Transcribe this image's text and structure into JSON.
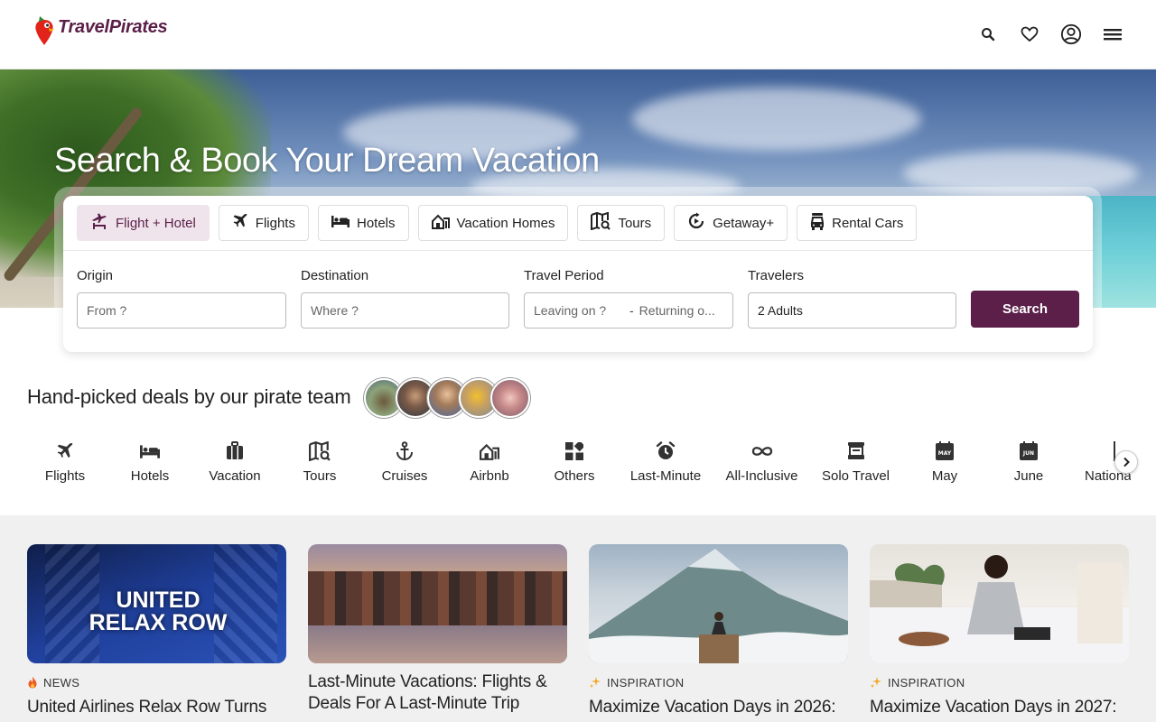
{
  "brand": {
    "name": "TravelPirates"
  },
  "header": {
    "icons": [
      "search-icon",
      "heart-icon",
      "account-icon",
      "menu-icon"
    ]
  },
  "hero": {
    "title": "Search & Book Your Dream Vacation"
  },
  "search": {
    "tabs": [
      {
        "label": "Flight + Hotel",
        "icon": "flight-hotel-icon",
        "active": true
      },
      {
        "label": "Flights",
        "icon": "plane-icon"
      },
      {
        "label": "Hotels",
        "icon": "bed-icon"
      },
      {
        "label": "Vacation Homes",
        "icon": "vacation-home-icon"
      },
      {
        "label": "Tours",
        "icon": "map-search-icon"
      },
      {
        "label": "Getaway+",
        "icon": "getaway-icon"
      },
      {
        "label": "Rental Cars",
        "icon": "car-icon"
      }
    ],
    "origin": {
      "label": "Origin",
      "placeholder": "From ?"
    },
    "destination": {
      "label": "Destination",
      "placeholder": "Where ?"
    },
    "period": {
      "label": "Travel Period",
      "leaving": "Leaving on ?",
      "separator": "-",
      "returning": "Returning o..."
    },
    "travelers": {
      "label": "Travelers",
      "value": "2 Adults"
    },
    "button": "Search"
  },
  "deals": {
    "title": "Hand-picked deals by our pirate team",
    "avatar_count": 5
  },
  "categories": [
    {
      "label": "Flights",
      "icon": "plane-icon"
    },
    {
      "label": "Hotels",
      "icon": "bed-icon"
    },
    {
      "label": "Vacation",
      "icon": "suitcase-icon"
    },
    {
      "label": "Tours",
      "icon": "map-search-icon"
    },
    {
      "label": "Cruises",
      "icon": "anchor-icon"
    },
    {
      "label": "Airbnb",
      "icon": "airbnb-icon"
    },
    {
      "label": "Others",
      "icon": "grid-icon"
    },
    {
      "label": "Last-Minute",
      "icon": "alarm-icon"
    },
    {
      "label": "All-Inclusive",
      "icon": "infinity-icon"
    },
    {
      "label": "Solo Travel",
      "icon": "backpack-icon"
    },
    {
      "label": "May",
      "icon": "calendar-may-icon"
    },
    {
      "label": "June",
      "icon": "calendar-june-icon"
    },
    {
      "label": "Nationa",
      "icon": "flag-icon"
    }
  ],
  "articles": [
    {
      "tag": "NEWS",
      "tag_icon": "fire-icon",
      "title": "United Airlines Relax Row Turns",
      "image_text": "UNITED RELAX ROW"
    },
    {
      "tag": "",
      "title": "Last-Minute Vacations: Flights & Deals For A Last-Minute Trip"
    },
    {
      "tag": "INSPIRATION",
      "tag_icon": "sparkle-icon",
      "title": "Maximize Vacation Days in 2026:"
    },
    {
      "tag": "INSPIRATION",
      "tag_icon": "sparkle-icon",
      "title": "Maximize Vacation Days in 2027:"
    }
  ],
  "colors": {
    "brand": "#5b1f49",
    "tab_active_bg": "#efe4ec",
    "articles_bg": "#f0f0f0"
  }
}
